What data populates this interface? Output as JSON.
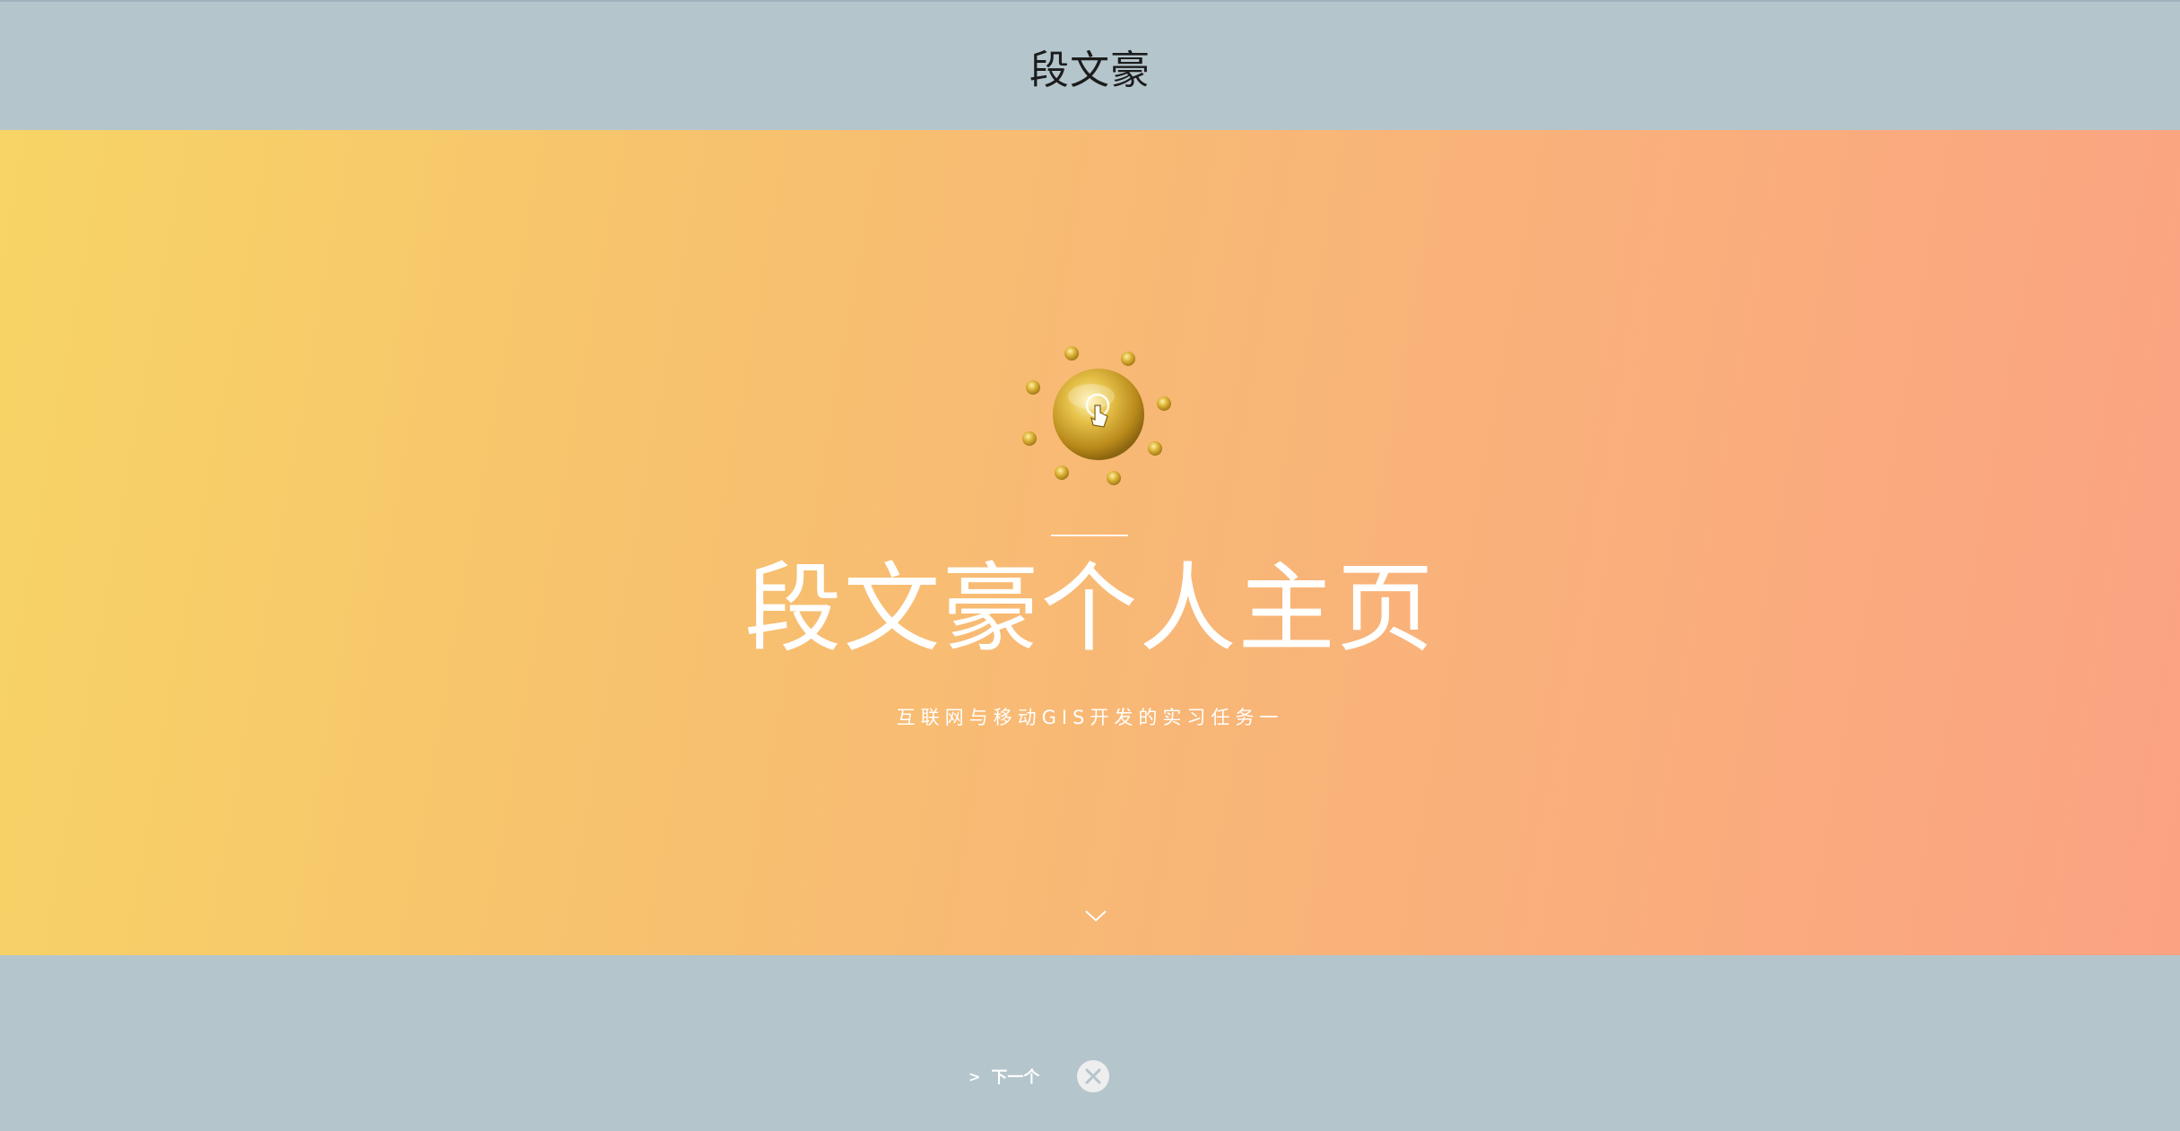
{
  "header": {
    "title": "段文豪"
  },
  "hero": {
    "logo_icon": "golden-orb-touch-icon",
    "title": "段文豪个人主页",
    "subtitle": "互联网与移动GIS开发的实习任务一",
    "scroll_icon": "chevron-down-icon"
  },
  "footer": {
    "next_arrow": ">",
    "next_label": "下一个",
    "close_icon": "close-icon"
  },
  "colors": {
    "header_bg": "#b4c5cc",
    "gradient_start": "#f7d465",
    "gradient_end": "#fba282",
    "text_light": "#ffffff"
  }
}
